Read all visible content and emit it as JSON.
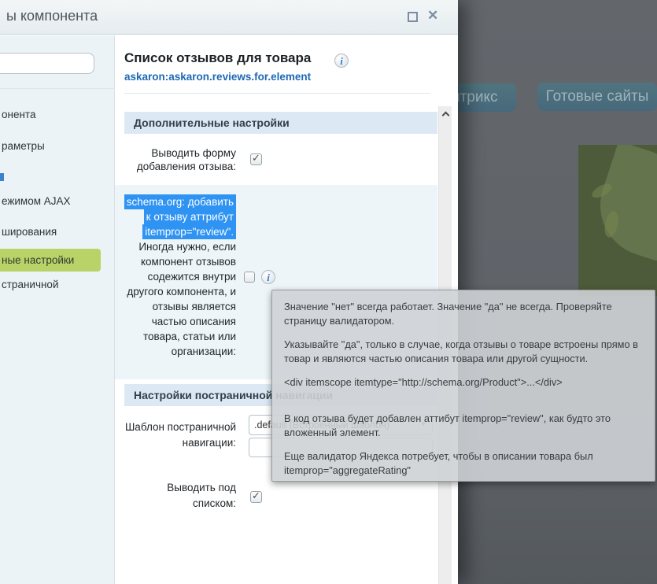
{
  "window": {
    "title_fragment": "ы компонента"
  },
  "backdrop": {
    "button_bitrix": "Битрикс",
    "button_ready_sites": "Готовые сайты"
  },
  "sidebar": {
    "items": [
      {
        "label": "онента"
      },
      {
        "label": "раметры"
      },
      {
        "label": "ежимом AJAX"
      },
      {
        "label": "ширования"
      },
      {
        "label": "ные настройки"
      },
      {
        "label": "страничной"
      }
    ]
  },
  "header": {
    "title": "Список отзывов для товара",
    "component_link": "askaron:askaron.reviews.for.element"
  },
  "section_additional": {
    "title": "Дополнительные настройки",
    "row_show_form": {
      "label_lines": [
        "Выводить форму",
        "добавления отзыва:"
      ],
      "checked": "✓"
    },
    "row_schema": {
      "highlight_lines": [
        "schema.org: добавить",
        "к отзыву аттрибут",
        "itemprop=\"review\"."
      ],
      "label_lines": [
        "Иногда нужно, если",
        "компонент отзывов",
        "содежится внутри",
        "другого компонента, и",
        "отзывы является",
        "частью описания",
        "товара, статьи или",
        "организации:"
      ]
    }
  },
  "section_pagenav": {
    "title": "Настройки постраничной навигации",
    "row_template": {
      "label_lines": [
        "Шаблон постраничной",
        "навигации:"
      ],
      "select_value": ".default (Встроенный шаблон)",
      "input_value": ""
    },
    "row_show_below": {
      "label_lines": [
        "Выводить под",
        "списком:"
      ],
      "checked": "✓"
    }
  },
  "tooltip": {
    "paragraphs": [
      "Значение \"нет\" всегда работает. Значение \"да\" не всегда. Проверяйте страницу валидатором.",
      "Указывайте \"да\", только в случае, когда отзывы о товаре встроены прямо в товар и являются частью описания товара или другой сущности.",
      "<div itemscope itemtype=\"http://schema.org/Product\">...</div>",
      "В код отзыва будет добавлен аттибут itemprop=\"review\", как будто это вложенный элемент.",
      "Еще валидатор Яндекса потребует, чтобы в описании товара был itemprop=\"aggregateRating\""
    ]
  },
  "colors": {
    "accent_selection": "#2e93f2",
    "sidebar_active": "#b9d368",
    "section_header_bg": "#dce9f4",
    "link_blue": "#1d69b4",
    "backdrop_dim": "#63676c"
  }
}
